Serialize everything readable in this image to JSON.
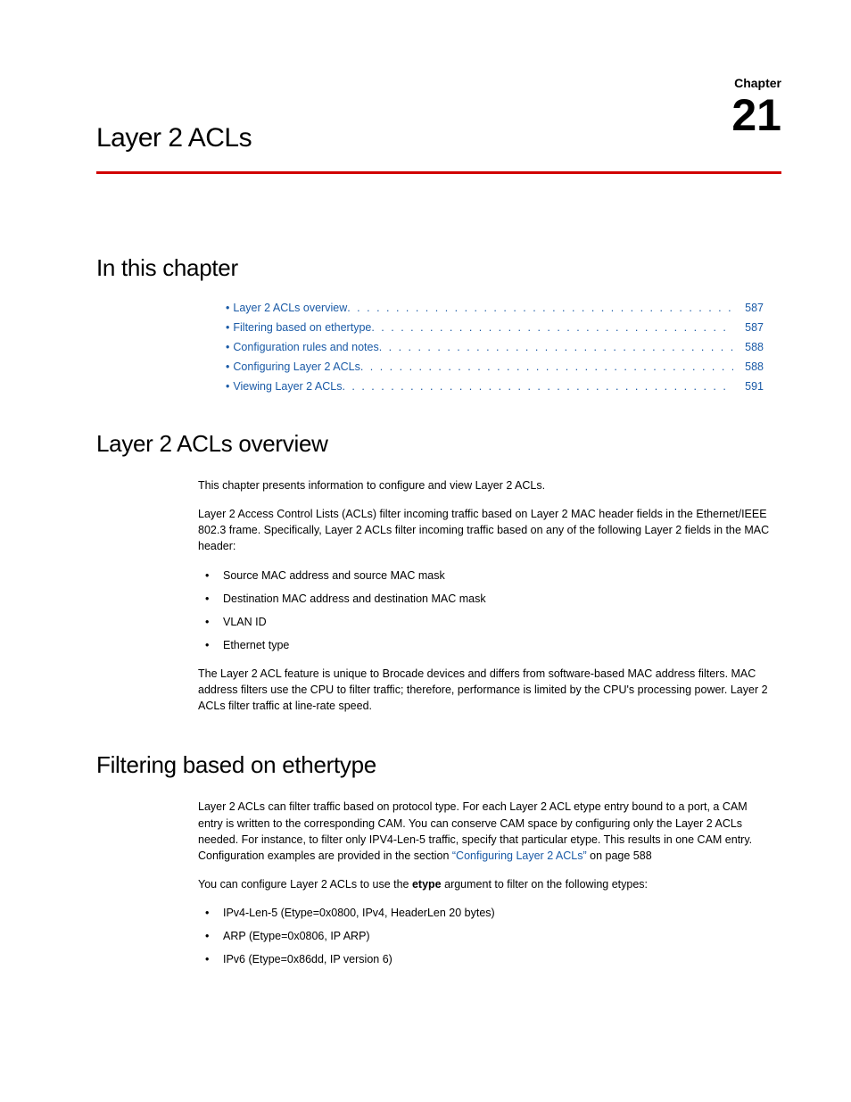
{
  "chapter": {
    "label": "Chapter",
    "number": "21",
    "title": "Layer 2 ACLs"
  },
  "sections": {
    "in_this_chapter": "In this chapter",
    "overview": "Layer 2 ACLs overview",
    "filtering": "Filtering based on ethertype"
  },
  "toc": [
    {
      "label": "Layer 2 ACLs overview",
      "page": "587"
    },
    {
      "label": "Filtering based on ethertype",
      "page": "587"
    },
    {
      "label": "Configuration rules and notes",
      "page": "588"
    },
    {
      "label": "Configuring Layer 2 ACLs",
      "page": "588"
    },
    {
      "label": "Viewing Layer 2 ACLs",
      "page": "591"
    }
  ],
  "overview": {
    "p1": "This chapter presents information to configure and view Layer 2 ACLs.",
    "p2": "Layer 2 Access Control Lists (ACLs) filter incoming traffic based on Layer 2 MAC header fields in the Ethernet/IEEE 802.3 frame. Specifically, Layer 2 ACLs filter incoming traffic based on any of the following Layer 2 fields in the MAC header:",
    "fields": [
      "Source MAC address and source MAC mask",
      "Destination MAC address and destination MAC mask",
      "VLAN ID",
      "Ethernet type"
    ],
    "p3": "The Layer 2 ACL feature is unique to Brocade devices and differs from software-based MAC address filters. MAC address filters use the CPU to filter traffic; therefore, performance is limited by the CPU's processing power. Layer 2 ACLs filter traffic at line-rate speed."
  },
  "filtering": {
    "p1_a": "Layer 2 ACLs can filter traffic based on protocol type. For each Layer 2 ACL etype entry bound to a port, a CAM entry is written to the corresponding CAM. You can conserve CAM space by configuring only the Layer 2 ACLs needed. For instance, to filter only IPV4-Len-5 traffic, specify that particular etype. This results in one CAM entry. Configuration examples are provided in the section ",
    "p1_link": "“Configuring Layer 2 ACLs”",
    "p1_b": " on page 588",
    "p2_a": "You can configure Layer 2 ACLs to use the ",
    "p2_bold": "etype",
    "p2_b": " argument to filter on the following etypes:",
    "etypes": [
      "IPv4-Len-5 (Etype=0x0800, IPv4, HeaderLen 20 bytes)",
      "ARP (Etype=0x0806, IP ARP)",
      "IPv6 (Etype=0x86dd, IP version 6)"
    ]
  }
}
